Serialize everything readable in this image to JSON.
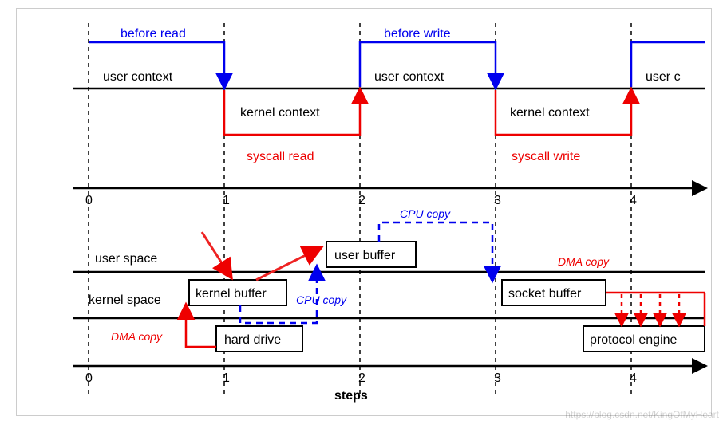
{
  "chart_data": {
    "type": "diagram",
    "title": "",
    "xlabel": "steps",
    "x_ticks": [
      "0",
      "1",
      "2",
      "3",
      "4"
    ],
    "top_diagram": {
      "rows": [
        "user context",
        "kernel context"
      ],
      "events": [
        {
          "label": "before read",
          "color": "blue",
          "from": 0,
          "to": 1,
          "row": "above"
        },
        {
          "label": "syscall read",
          "color": "red",
          "from": 1,
          "to": 2,
          "row": "below"
        },
        {
          "label": "before write",
          "color": "blue",
          "from": 2,
          "to": 3,
          "row": "above"
        },
        {
          "label": "syscall write",
          "color": "red",
          "from": 3,
          "to": 4,
          "row": "below"
        }
      ]
    },
    "bottom_diagram": {
      "rows": [
        "user space",
        "kernel space"
      ],
      "nodes": [
        {
          "id": "user_buffer",
          "label": "user buffer",
          "row": "user space",
          "at": 2
        },
        {
          "id": "kernel_buffer",
          "label": "kernel buffer",
          "row": "kernel space",
          "at": 1
        },
        {
          "id": "socket_buffer",
          "label": "socket buffer",
          "row": "kernel space",
          "at": 3
        },
        {
          "id": "hard_drive",
          "label": "hard drive",
          "row": "below",
          "at": 1
        },
        {
          "id": "protocol_engine",
          "label": "protocol engine",
          "row": "below",
          "at": 4
        }
      ],
      "edges": [
        {
          "from": "hard_drive",
          "to": "kernel_buffer",
          "label": "DMA copy",
          "color": "red",
          "style": "solid"
        },
        {
          "from": "kernel_buffer",
          "to": "user_buffer",
          "label": "CPU copy",
          "color": "blue",
          "style": "dashed"
        },
        {
          "from": "user_buffer",
          "to": "socket_buffer",
          "label": "CPU copy",
          "color": "blue",
          "style": "dashed"
        },
        {
          "from": "socket_buffer",
          "to": "protocol_engine",
          "label": "DMA copy",
          "color": "red",
          "style": "dashed"
        }
      ],
      "annotation_arrows": [
        "red-arrow to kernel buffer",
        "red-arrow to user buffer"
      ]
    }
  },
  "labels": {
    "before_read": "before read",
    "before_write": "before write",
    "user_context_1": "user context",
    "user_context_2": "user context",
    "user_context_3": "user c",
    "kernel_context_1": "kernel context",
    "kernel_context_2": "kernel context",
    "syscall_read": "syscall read",
    "syscall_write": "syscall write",
    "user_space": "user space",
    "kernel_space": "kernel space",
    "user_buffer": "user buffer",
    "kernel_buffer": "kernel buffer",
    "socket_buffer": "socket buffer",
    "hard_drive": "hard drive",
    "protocol_engine": "protocol engine",
    "dma_copy_1": "DMA copy",
    "dma_copy_2": "DMA copy",
    "cpu_copy_1": "CPU copy",
    "cpu_copy_2": "CPU copy",
    "xlabel": "steps",
    "t0": "0",
    "t1": "1",
    "t2": "2",
    "t3": "3",
    "t4": "4",
    "b0": "0",
    "b1": "1",
    "b2": "2",
    "b3": "3",
    "b4": "4"
  },
  "watermark": "https://blog.csdn.net/KingOfMyHeart"
}
